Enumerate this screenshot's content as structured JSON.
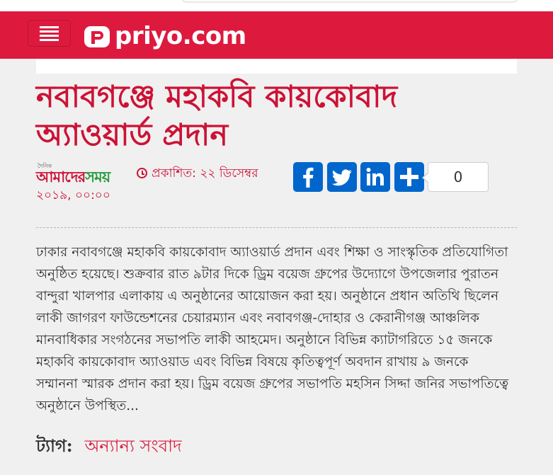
{
  "site": {
    "name": "priyo.com",
    "brand_color": "#dd1a3e"
  },
  "icons": {
    "menu": "hamburger-icon",
    "clock": "clock-icon",
    "facebook": "facebook-icon",
    "twitter": "twitter-icon",
    "linkedin": "linkedin-icon",
    "share": "share-plus-icon"
  },
  "article": {
    "headline": "নবাবগঞ্জে মহাকবি কায়কোবাদ অ্যাওয়ার্ড প্রদান",
    "source": {
      "small": "দৈনিক",
      "name_part1": "আমাদের",
      "name_part2": "সময়"
    },
    "published_label": "প্রকাশিত:",
    "published_date": "২২ ডিসেম্বর ২০১৯, ০০:০০",
    "share_count": "0",
    "body": "ঢাকার নবাবগঞ্জে মহাকবি কায়কোবাদ অ্যাওয়ার্ড প্রদান এবং শিক্ষা ও সাংস্কৃতিক প্রতিযোগিতা অনুষ্ঠিত হয়েছে। শুক্রবার রাত ৯টার দিকে ড্রিম বয়েজ গ্রুপের উদ্যোগে উপজেলার পুরাতন বান্দুরা খালপার এলাকায় এ অনুষ্ঠানের আয়োজন করা হয়। অনুষ্ঠানে প্রধান অতিথি ছিলেন লাকী জাগরণ ফাউন্ডেশনের চেয়ারম্যান এবং নবাবগঞ্জ-দোহার ও কেরানীগঞ্জ আঞ্চলিক মানবাধিকার সংগঠনের সভাপতি লাকী আহমেদ। অনুষ্ঠানে বিভিন্ন ক্যাটাগরিতে ১৫ জনকে মহাকবি কায়কোবাদ অ্যাওয়াড এবং বিভিন্ন বিষয়ে কৃতিত্বপূর্ণ অবদান রাখায় ৯ জনকে সম্মাননা স্মারক প্রদান করা হয়। ড্রিম বয়েজ গ্রুপের সভাপতি মহসিন সিদ্দা জনির সভাপতিত্বে অনুষ্ঠানে উপস্থিত...",
    "tags_label": "ট্যাগ:",
    "tags": [
      "অন্যান্য সংবাদ"
    ]
  },
  "colors": {
    "headline": "#cc1235",
    "share_button": "#0066cc",
    "background": "#f0f0f0"
  }
}
